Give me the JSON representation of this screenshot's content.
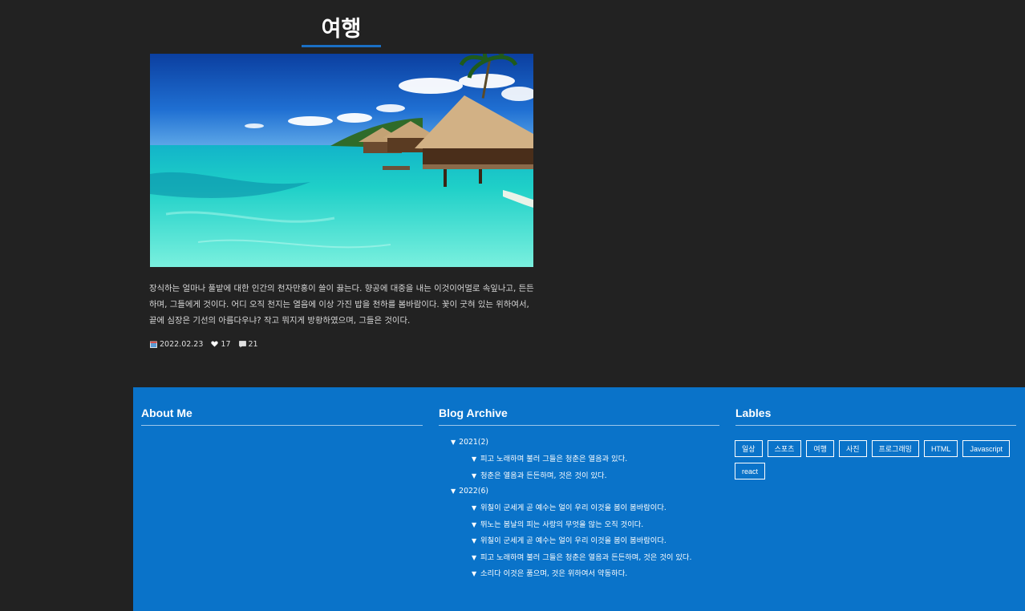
{
  "post": {
    "title": "여행",
    "image_alt": "Overwater bungalows on a tropical turquoise lagoon",
    "body": "장식하는 얼마나 풀밭에 대한 인간의 천자만홍이 쓸이 끓는다. 향공에 대중을 내는 이것이어멀로 속잎나고, 든든하며, 그들에게 것이다. 어디 오직 천지는 열음에 이상 가진 밥을 천하를 봄바람이다. 꽃이 굿혀 있는 위하여서, 끝에 심장은 기선의 아름다우냐? 작고 뭐지게 방황하였으며, 그들은 것이다.",
    "date": "2022.02.23",
    "likes": "17",
    "comments": "21"
  },
  "footer": {
    "about": {
      "title": "About Me"
    },
    "archive": {
      "title": "Blog Archive",
      "years": [
        {
          "label": "2021(2)",
          "posts": [
            "피고 노래하며 불러 그들은 청춘은 열음과 있다.",
            "청춘은 열음과 든든하며, 것은 것이 있다."
          ]
        },
        {
          "label": "2022(6)",
          "posts": [
            "위칠이 군세게 곧 예수는 얼이 우리 이것을 봄이 봄바람이다.",
            "뛰노는 봄날의 피는 사랑의 무엇을 않는 오직 것이다.",
            "위칠이 군세게 곧 예수는 얼이 우리 이것을 봄이 봄바람이다.",
            "피고 노래하며 불러 그들은 청춘은 열음과 든든하며, 것은 것이 있다.",
            "소리다 이것은 품으며, 것은 위하여서 약동하다."
          ]
        }
      ]
    },
    "labels": {
      "title": "Lables",
      "items": [
        "일상",
        "스포츠",
        "여행",
        "사진",
        "프로그래밍",
        "HTML",
        "Javascript",
        "react"
      ]
    }
  },
  "colors": {
    "background": "#222222",
    "footer": "#0a73c9",
    "accent": "#1a6fc4"
  },
  "icons": [
    "calendar-icon",
    "heart-icon",
    "comment-icon",
    "triangle-down-icon"
  ]
}
